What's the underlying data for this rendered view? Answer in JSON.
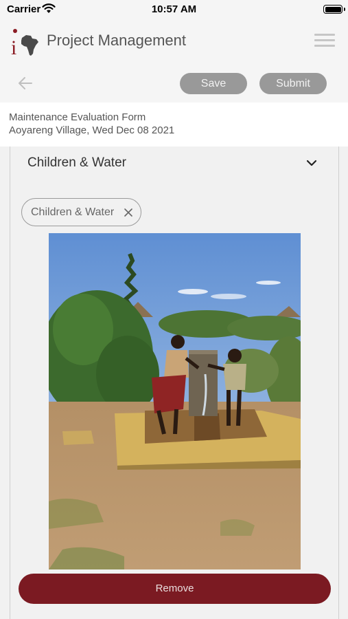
{
  "status_bar": {
    "carrier": "Carrier",
    "time": "10:57 AM"
  },
  "header": {
    "logo_letter": "i",
    "title": "Project Management",
    "save_label": "Save",
    "submit_label": "Submit"
  },
  "form": {
    "name": "Maintenance Evaluation Form",
    "subtitle": "Aoyareng Village, Wed Dec 08 2021"
  },
  "section": {
    "title": "Children & Water",
    "tag_label": "Children & Water",
    "remove_label": "Remove"
  },
  "colors": {
    "brand": "#7b1a22",
    "button_gray": "#999999",
    "header_bg": "#f5f5f5"
  }
}
